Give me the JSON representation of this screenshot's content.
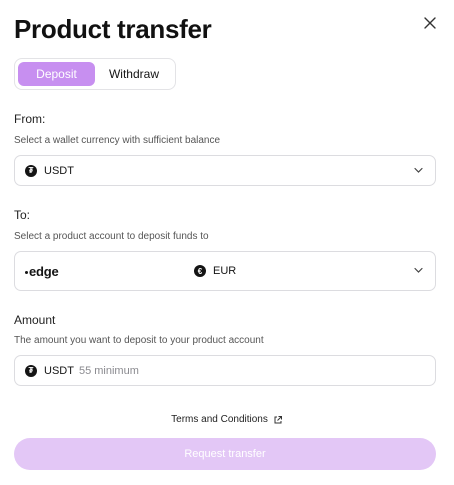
{
  "title": "Product transfer",
  "tabs": {
    "deposit": "Deposit",
    "withdraw": "Withdraw",
    "active": "Deposit"
  },
  "from": {
    "label": "From:",
    "help": "Select a wallet currency with sufficient balance",
    "currency": "USDT",
    "currency_icon": "tether-icon"
  },
  "to": {
    "label": "To:",
    "help": "Select a product account to deposit funds to",
    "brand": "edge",
    "currency": "EUR",
    "currency_icon": "euro-icon"
  },
  "amount": {
    "label": "Amount",
    "help": "The amount you want to deposit to your product account",
    "currency": "USDT",
    "placeholder": "55 minimum"
  },
  "terms_label": "Terms and Conditions",
  "submit_label": "Request transfer",
  "colors": {
    "accent": "#c78ff0",
    "disabled_button": "#e3c7f6",
    "border": "#dcdce0"
  }
}
